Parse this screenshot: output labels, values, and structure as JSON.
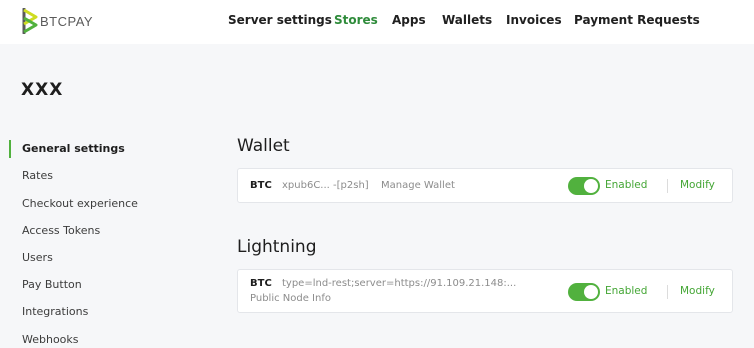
{
  "header": {
    "logo_text": "BTCPAY",
    "nav": [
      "Server settings",
      "Stores",
      "Apps",
      "Wallets",
      "Invoices",
      "Payment Requests"
    ],
    "active_nav": "Stores"
  },
  "store": {
    "name": "XXX"
  },
  "sidebar": {
    "items": [
      "General settings",
      "Rates",
      "Checkout experience",
      "Access Tokens",
      "Users",
      "Pay Button",
      "Integrations",
      "Webhooks"
    ],
    "active": "General settings"
  },
  "wallet": {
    "title": "Wallet",
    "currency": "BTC",
    "derivation": "xpub6C... -[p2sh]",
    "manage_label": "Manage Wallet",
    "status": "Enabled",
    "modify_label": "Modify"
  },
  "lightning": {
    "title": "Lightning",
    "currency": "BTC",
    "connection": "type=lnd-rest;server=https://91.109.21.148:...",
    "node_info_label": "Public Node Info",
    "status": "Enabled",
    "modify_label": "Modify"
  },
  "colors": {
    "accent": "#51b13e",
    "link": "#44a635",
    "active_nav": "#2e8b3a"
  }
}
